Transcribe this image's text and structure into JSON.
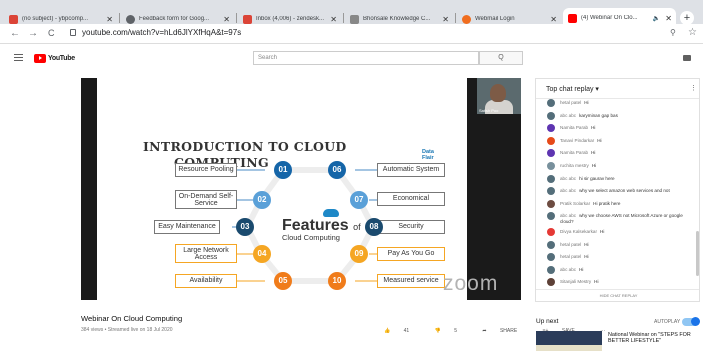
{
  "browser": {
    "tabs": [
      {
        "label": "(no subject) - ybpcomp...",
        "color": "#db4437"
      },
      {
        "label": "Feedback form for Goog...",
        "color": "#5f6368"
      },
      {
        "label": "Inbox (4,006) - zendesk...",
        "color": "#db4437"
      },
      {
        "label": "Bhonsale Knowledge C...",
        "color": "#777777"
      },
      {
        "label": "Webmail Login",
        "color": "#f06d1f"
      },
      {
        "label": "(4) Webinar On Clo...",
        "color": "#ff0000"
      }
    ],
    "new_tab": "+",
    "back": "←",
    "forward": "→",
    "reload": "C",
    "url": "youtube.com/watch?v=hLd6JlYXfHqA&t=97s",
    "zoom_icon": "magnifier-icon",
    "star": "☆"
  },
  "youtube": {
    "logo_text": "YouTube",
    "search_placeholder": "Search",
    "search_button": "Q"
  },
  "slide": {
    "title_line1": "INTRODUCTION TO CLOUD",
    "title_line2": "COMPUTING",
    "logo_line1": "Data",
    "logo_line2": "Flair",
    "center_title": "Features",
    "center_of": "of",
    "center_sub": "Cloud Computing",
    "presenter": "Satish Poo",
    "watermark": "zoom",
    "features_left": [
      {
        "num": "01",
        "label": "Resource Pooling"
      },
      {
        "num": "02",
        "label": "On-Demand Self-Service"
      },
      {
        "num": "03",
        "label": "Easy Maintenance"
      },
      {
        "num": "04",
        "label": "Large Network Access"
      },
      {
        "num": "05",
        "label": "Availability"
      }
    ],
    "features_right": [
      {
        "num": "06",
        "label": "Automatic System"
      },
      {
        "num": "07",
        "label": "Economical"
      },
      {
        "num": "08",
        "label": "Security"
      },
      {
        "num": "09",
        "label": "Pay As You Go"
      },
      {
        "num": "10",
        "label": "Measured service"
      }
    ]
  },
  "chat": {
    "header": "Top chat replay ▾",
    "more": "⋮",
    "footer": "HIDE CHAT REPLAY",
    "messages": [
      {
        "author": "hetal patel",
        "text": "Hi",
        "color": "#546e7a"
      },
      {
        "author": "abc abc",
        "text": "karyminan gap bas",
        "color": "#546e7a"
      },
      {
        "author": "Namita Parab",
        "text": "Hi",
        "color": "#5e35b1"
      },
      {
        "author": "Tanavi Pindarkar",
        "text": "Hi",
        "color": "#e64a19"
      },
      {
        "author": "Namita Parab",
        "text": "Hi",
        "color": "#5e35b1"
      },
      {
        "author": "ruchita mestry",
        "text": "Hi",
        "color": "#78909c"
      },
      {
        "author": "abc abc",
        "text": "hi sir gaurav here",
        "color": "#546e7a"
      },
      {
        "author": "abc abc",
        "text": "why we select amazon web services and not",
        "color": "#546e7a"
      },
      {
        "author": "Pratik Solarkar",
        "text": "Hi pratik here",
        "color": "#6d4c41"
      },
      {
        "author": "abc abc",
        "text": "why we choose AWS not Microsoft Azure or google cloud?",
        "color": "#546e7a"
      },
      {
        "author": "Divya Kalsekarkar",
        "text": "Hi",
        "color": "#e53935"
      },
      {
        "author": "hetal patel",
        "text": "Hi",
        "color": "#546e7a"
      },
      {
        "author": "hetal patel",
        "text": "Hi",
        "color": "#546e7a"
      },
      {
        "author": "abc abc",
        "text": "Hi",
        "color": "#546e7a"
      },
      {
        "author": "Sitanjali Mestry",
        "text": "Hi",
        "color": "#5d4037"
      }
    ]
  },
  "video": {
    "title": "Webinar On Cloud Computing",
    "meta": "384 views • Streamed live on 18 Jul 2020",
    "likes": "41",
    "dislikes": "5",
    "share": "SHARE",
    "save": "SAVE",
    "more": "···"
  },
  "sidebar": {
    "upnext": "Up next",
    "autoplay": "AUTOPLAY",
    "next_title": "National Webinar on \"STEPS FOR BETTER LIFESTYLE\""
  }
}
